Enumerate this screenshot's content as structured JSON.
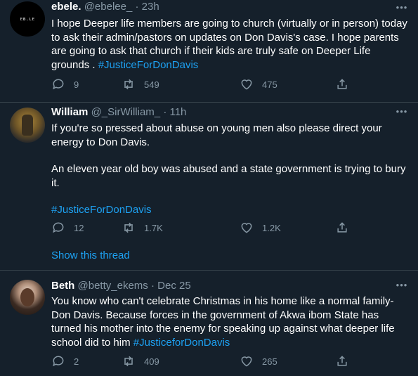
{
  "tweets": [
    {
      "name": "ebele.",
      "handle": "@ebelee_",
      "separator": "·",
      "time": "23h",
      "avatar_text": "ᴇʙ.ʟᴇ",
      "text": "I hope Deeper life members are going to church (virtually or in person) today to ask their admin/pastors on updates on Don Davis's case. I hope parents are going to ask that church if their kids are truly safe on Deeper Life grounds . ",
      "hashtag": "#JusticeForDonDavis",
      "replies": "9",
      "retweets": "549",
      "likes": "475"
    },
    {
      "name": "William",
      "handle": "@_SirWilliam_",
      "separator": "·",
      "time": "11h",
      "text_p1": "If you're so pressed about abuse on young men also please direct your energy to Don Davis.",
      "text_p2": "An eleven year old boy was abused and a state government is trying to bury it.",
      "hashtag": "#JusticeForDonDavis",
      "replies": "12",
      "retweets": "1.7K",
      "likes": "1.2K",
      "show_thread": "Show this thread"
    },
    {
      "name": "Beth",
      "handle": "@betty_ekems",
      "separator": "·",
      "time": "Dec 25",
      "text": "You know who can't celebrate Christmas in his home like a normal family- Don Davis. Because forces in the government of Akwa ibom State has turned his mother into the enemy for speaking up against what deeper life school did to him ",
      "hashtag": "#JusticeforDonDavis",
      "replies": "2",
      "retweets": "409",
      "likes": "265"
    }
  ],
  "icons": {
    "more": "more-horizontal-icon",
    "reply": "reply-icon",
    "retweet": "retweet-icon",
    "like": "heart-icon",
    "share": "share-icon"
  },
  "colors": {
    "background": "#15202b",
    "link": "#1da1f2",
    "muted": "#8899a6",
    "divider": "#38444d"
  }
}
